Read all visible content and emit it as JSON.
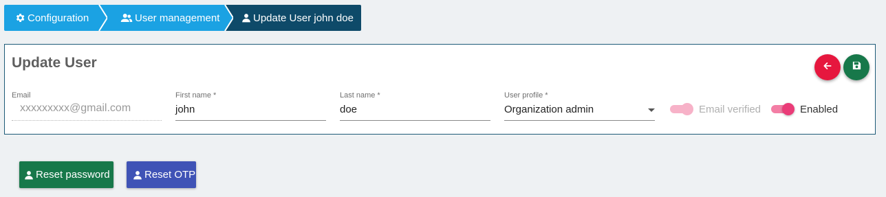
{
  "breadcrumb": {
    "items": [
      {
        "label": "Configuration",
        "icon": "gear-icon"
      },
      {
        "label": "User management",
        "icon": "users-icon"
      },
      {
        "label": "Update User john doe",
        "icon": "user-icon"
      }
    ]
  },
  "card": {
    "title": "Update User",
    "actions": {
      "back_icon": "arrow-left-icon",
      "save_icon": "floppy-disk-icon"
    }
  },
  "form": {
    "email": {
      "label": "Email",
      "value": "xxxxxxxxx@gmail.com"
    },
    "first_name": {
      "label": "First name *",
      "value": "john"
    },
    "last_name": {
      "label": "Last name *",
      "value": "doe"
    },
    "user_profile": {
      "label": "User profile *",
      "value": "Organization admin"
    },
    "email_verified": {
      "label": "Email verified",
      "on": true,
      "disabled": true
    },
    "enabled": {
      "label": "Enabled",
      "on": true,
      "disabled": false
    }
  },
  "buttons": {
    "reset_password": "Reset password",
    "reset_otp": "Reset OTP"
  },
  "colors": {
    "breadcrumb_primary": "#1ba2e3",
    "breadcrumb_active": "#0e4a69",
    "back_button": "#e6173e",
    "save_button": "#17784a",
    "reset_password_button": "#17784a",
    "reset_otp_button": "#3f53b6",
    "toggle_on": "#ea3c78"
  }
}
